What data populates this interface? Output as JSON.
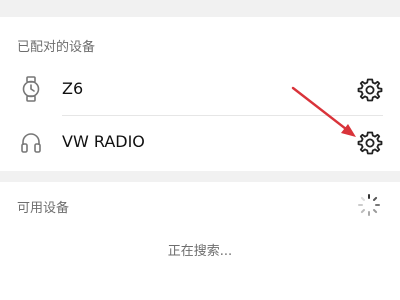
{
  "paired": {
    "header": "已配对的设备",
    "devices": [
      {
        "name": "Z6",
        "icon": "watch-icon"
      },
      {
        "name": "VW RADIO",
        "icon": "headphones-icon"
      }
    ]
  },
  "available": {
    "header": "可用设备",
    "status": "正在搜索..."
  },
  "colors": {
    "arrow": "#d9333a",
    "section_band": "#f1f1f1",
    "muted_text": "#6e6e6e"
  }
}
